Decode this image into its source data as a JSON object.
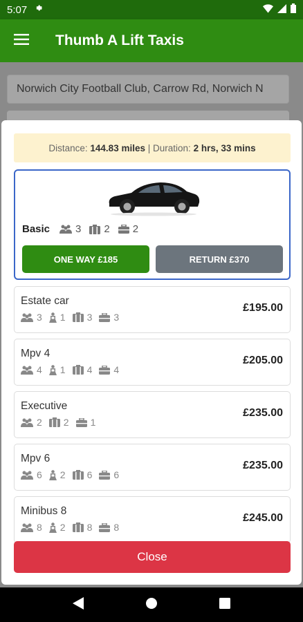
{
  "status": {
    "time": "5:07"
  },
  "app": {
    "title": "Thumb A Lift Taxis"
  },
  "search": {
    "pickup_value": "Norwich City Football Club, Carrow Rd, Norwich N"
  },
  "trip": {
    "distance_label": "Distance:",
    "distance_value": "144.83 miles",
    "separator": "|",
    "duration_label": "Duration:",
    "duration_value": "2 hrs, 33 mins"
  },
  "selected": {
    "name": "Basic",
    "passengers": "3",
    "luggage": "2",
    "handbags": "2",
    "one_way_label": "ONE WAY £185",
    "return_label": "RETURN £370"
  },
  "vehicles": [
    {
      "name": "Estate car",
      "passengers": "3",
      "child_seats": "1",
      "luggage": "3",
      "handbags": "3",
      "price": "£195.00"
    },
    {
      "name": "Mpv 4",
      "passengers": "4",
      "child_seats": "1",
      "luggage": "4",
      "handbags": "4",
      "price": "£205.00"
    },
    {
      "name": "Executive",
      "passengers": "2",
      "luggage": "2",
      "handbags": "1",
      "price": "£235.00"
    },
    {
      "name": "Mpv 6",
      "passengers": "6",
      "child_seats": "2",
      "luggage": "6",
      "handbags": "6",
      "price": "£235.00"
    },
    {
      "name": "Minibus 8",
      "passengers": "8",
      "child_seats": "2",
      "luggage": "8",
      "handbags": "8",
      "price": "£245.00"
    }
  ],
  "close_label": "Close",
  "colors": {
    "brand": "#2f8c12",
    "status_bar": "#1f6b0c",
    "close": "#dc3545",
    "return": "#6c757d",
    "selected_border": "#3a66c8",
    "info_bg": "#fdf2cf"
  }
}
